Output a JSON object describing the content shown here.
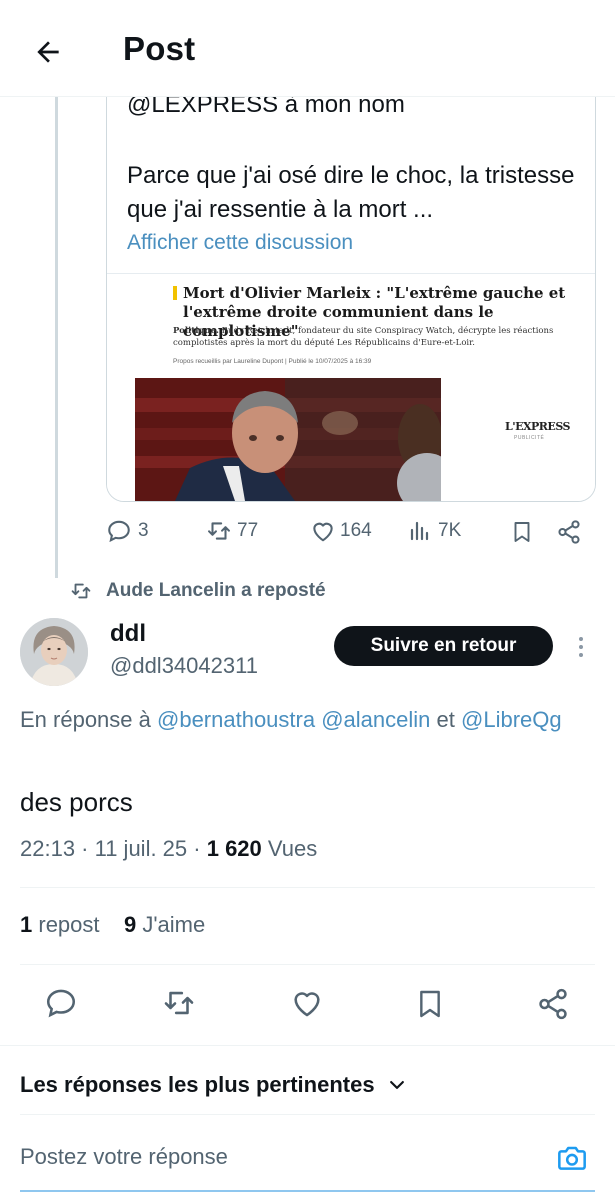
{
  "header": {
    "title": "Post"
  },
  "quoted_post": {
    "text_line_1": "@LEXPRESS à mon nom",
    "text_paragraph": "Parce que j'ai osé dire le choc, la tristesse que j'ai ressentie à la mort ...",
    "show_thread_link": "Afficher cette discussion",
    "article": {
      "headline": "Mort d'Olivier Marleix : \"L'extrême gauche et l'extrême droite communient dans le complotisme\"",
      "lede_category": "Politique.",
      "lede": "Rudy Reichstadt, fondateur du site Conspiracy Watch, décrypte les réactions complotistes après la mort du député Les Républicains d'Eure-et-Loir.",
      "byline": "Propos recueillis par Laureline Dupont  |  Publié le 10/07/2025 à 16:39",
      "brand": "L'EXPRESS",
      "brand_sub": "PUBLICITÉ"
    },
    "actions": {
      "replies": "3",
      "reposts": "77",
      "likes": "164",
      "views": "7K"
    }
  },
  "repost_note": "Aude Lancelin a reposté",
  "main_post": {
    "user_name": "ddl",
    "handle": "@ddl34042311",
    "follow_label": "Suivre en retour",
    "reply_prefix": "En réponse à",
    "mentions": [
      "@bernathoustra",
      "@alancelin"
    ],
    "mention_joiner": "et",
    "mention_last": "@LibreQg",
    "text": "des porcs",
    "time": "22:13 · 11 juil. 25 ·",
    "views_count": "1 620",
    "views_label": "Vues",
    "repost_count": "1",
    "repost_label": "repost",
    "like_count": "9",
    "like_label": "J'aime"
  },
  "replies_section": {
    "sort_label": "Les réponses les plus pertinentes",
    "reply_placeholder": "Postez votre réponse"
  },
  "colors": {
    "link": "#4a8fbf",
    "muted": "#536471",
    "button_bg": "#0f1419"
  }
}
